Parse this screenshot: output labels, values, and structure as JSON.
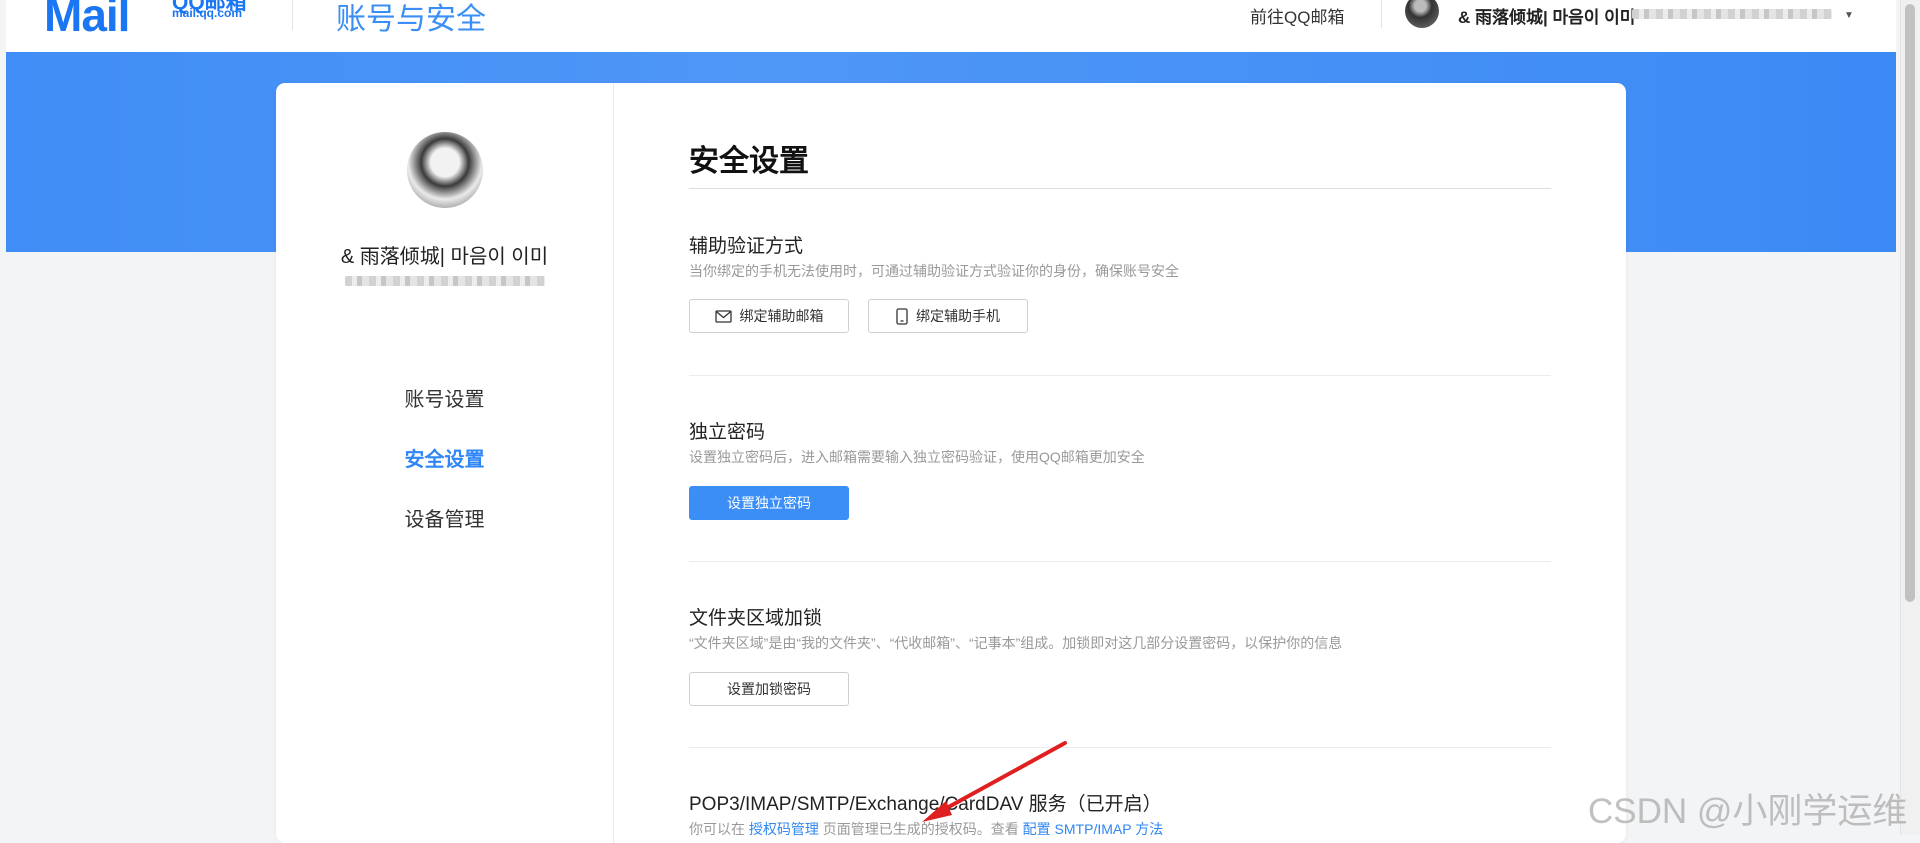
{
  "header": {
    "logo_mail": "Mail",
    "logo_qq": "QQ邮箱",
    "logo_domain": "mail.qq.com",
    "title": "账号与安全",
    "goto_link": "前往QQ邮箱",
    "username": "& 雨落倾城| 마음이 이미"
  },
  "sidebar": {
    "username": "& 雨落倾城| 마음이 이미",
    "nav": [
      {
        "label": "账号设置"
      },
      {
        "label": "安全设置",
        "active": true
      },
      {
        "label": "设备管理"
      }
    ]
  },
  "main": {
    "title": "安全设置",
    "sections": [
      {
        "title": "辅助验证方式",
        "desc": "当你绑定的手机无法使用时，可通过辅助验证方式验证你的身份，确保账号安全",
        "buttons": [
          "绑定辅助邮箱",
          "绑定辅助手机"
        ]
      },
      {
        "title": "独立密码",
        "desc": "设置独立密码后，进入邮箱需要输入独立密码验证，使用QQ邮箱更加安全",
        "buttons": [
          "设置独立密码"
        ]
      },
      {
        "title": "文件夹区域加锁",
        "desc": "“文件夹区域”是由“我的文件夹”、“代收邮箱”、“记事本”组成。加锁即对这几部分设置密码，以保护你的信息",
        "buttons": [
          "设置加锁密码"
        ]
      },
      {
        "title": "POP3/IMAP/SMTP/Exchange/CardDAV 服务（已开启）",
        "desc_prefix": "你可以在",
        "desc_link1": "授权码管理",
        "desc_middle": "页面管理已生成的授权码。查看",
        "desc_link2": "配置 SMTP/IMAP 方法"
      }
    ]
  },
  "watermark": "CSDN @小刚学运维",
  "colors": {
    "accent": "#3a8ef6",
    "band": "#4f97f7",
    "annotation_arrow": "#e02020"
  }
}
